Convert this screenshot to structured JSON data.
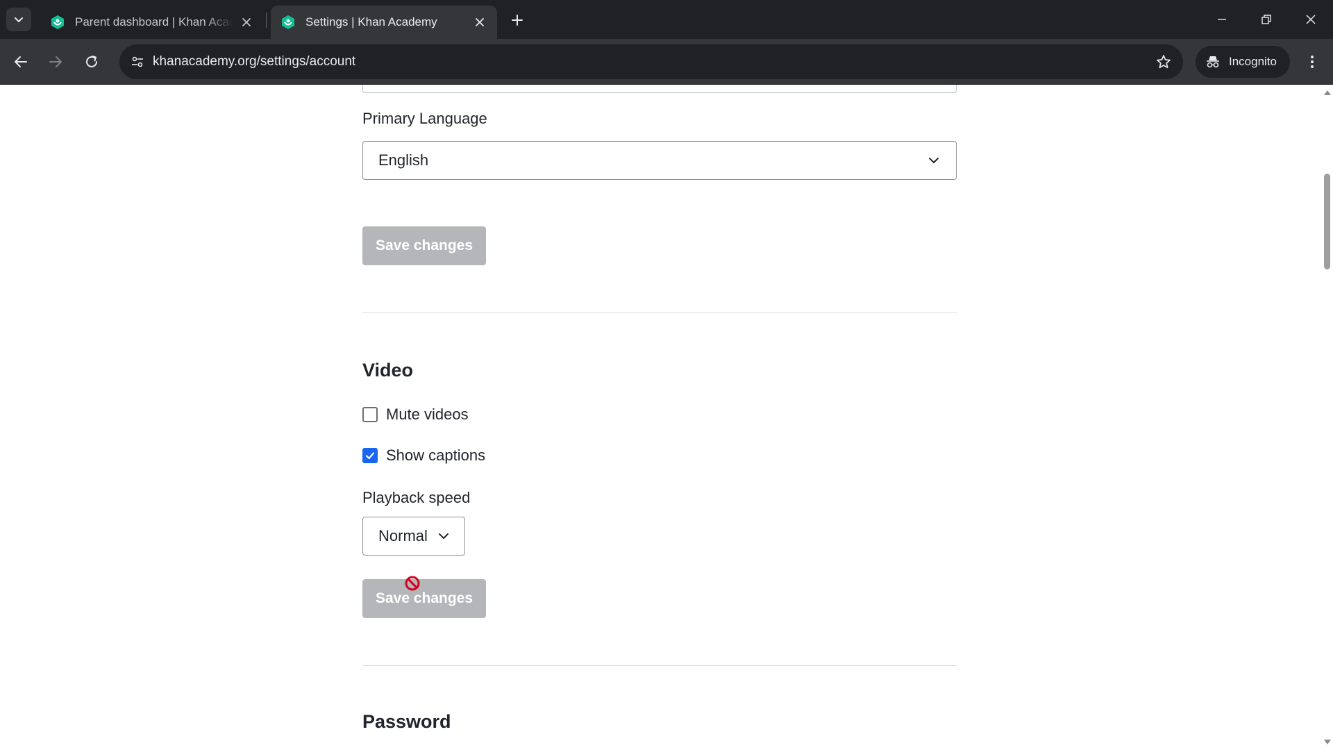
{
  "browser": {
    "tabs": [
      {
        "title": "Parent dashboard | Khan Academy",
        "active": false
      },
      {
        "title": "Settings | Khan Academy",
        "active": true
      }
    ],
    "url": "khanacademy.org/settings/account",
    "incognito_label": "Incognito"
  },
  "colors": {
    "khan_green": "#14bf96",
    "checkbox_blue": "#1865f2",
    "disabled_button": "#b5b6b9"
  },
  "page": {
    "language": {
      "label": "Primary Language",
      "selected": "English"
    },
    "language_save_label": "Save changes",
    "video": {
      "heading": "Video",
      "mute_label": "Mute videos",
      "mute_checked": false,
      "captions_label": "Show captions",
      "captions_checked": true,
      "speed_label": "Playback speed",
      "speed_selected": "Normal",
      "save_label": "Save changes"
    },
    "password": {
      "heading": "Password"
    }
  },
  "icons": {
    "favicon": "khan-academy-leaf-icon",
    "cursor": "not-allowed-cursor-icon"
  }
}
